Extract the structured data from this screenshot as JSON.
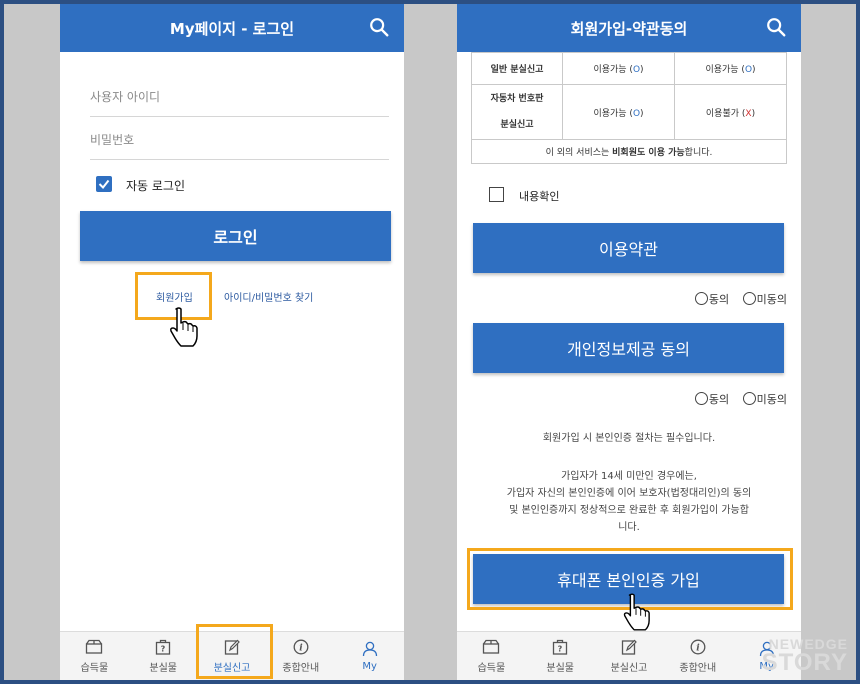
{
  "left": {
    "title": "My페이지 - 로그인",
    "user_id_placeholder": "사용자 아이디",
    "password_placeholder": "비밀번호",
    "auto_login_label": "자동 로그인",
    "login_button": "로그인",
    "signup_link": "회원가입",
    "find_link": "아이디/비밀번호 찾기",
    "nav": [
      "습득물",
      "분실물",
      "분실신고",
      "종합안내",
      "My"
    ]
  },
  "right": {
    "title": "회원가입-약관동의",
    "table": {
      "rows": [
        {
          "label": "일반 분실신고",
          "c1_text": "이용가능",
          "c1_mark": "O",
          "c2_text": "이용가능",
          "c2_mark": "O"
        },
        {
          "label_line1": "자동차 번호판",
          "label_line2": "분실신고",
          "c1_text": "이용가능",
          "c1_mark": "O",
          "c2_text": "이용불가",
          "c2_mark": "X"
        }
      ],
      "footer_pre": "이 외의 서비스는 ",
      "footer_bold": "비회원도 이용 가능",
      "footer_post": "합니다."
    },
    "content_confirm": "내용확인",
    "terms_button": "이용약관",
    "privacy_button": "개인정보제공 동의",
    "agree": "동의",
    "disagree": "미동의",
    "notice1": "회원가입 시 본인인증 절차는 필수입니다.",
    "notice2": [
      "가입자가 14세 미만인 경우에는,",
      "가입자 자신의 본인인증에 이어 보호자(법정대리인)의 동의",
      "및 본인인증까지 정상적으로 완료한 후 회원가입이 가능합",
      "니다."
    ],
    "phone_verify_button": "휴대폰 본인인증 가입",
    "nav": [
      "습득물",
      "분실물",
      "분실신고",
      "종합안내",
      "My"
    ]
  },
  "watermark": {
    "line1": "NEWEDGE",
    "line2": "STORY"
  },
  "colors": {
    "primary": "#2f6fc1",
    "highlight": "#f4a81c",
    "frame": "#2c4f82",
    "disallowed": "#d03030"
  }
}
